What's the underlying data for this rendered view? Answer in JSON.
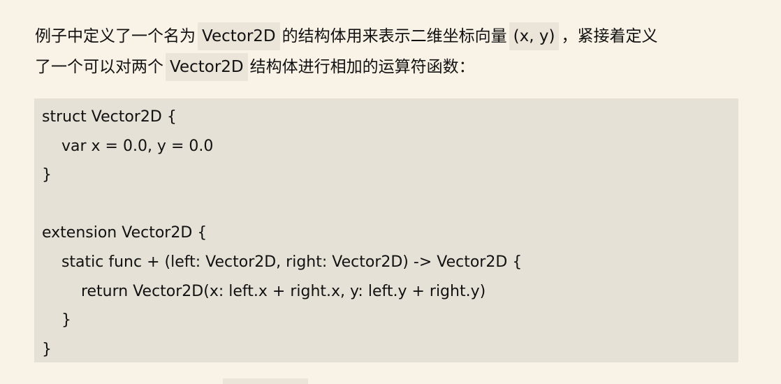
{
  "paragraph": {
    "line1": {
      "t1": "例子中定义了一个名为",
      "c1": "Vector2D",
      "t2": "的结构体用来表示二维坐标向量",
      "c2": "(x, y)",
      "t3": "，紧接着定义"
    },
    "line2": {
      "t1": "了一个可以对两个",
      "c1": "Vector2D",
      "t2": "结构体进行相加的运算符函数："
    }
  },
  "code_lines": [
    "struct Vector2D {",
    "    var x = 0.0, y = 0.0",
    "}",
    "",
    "extension Vector2D {",
    "    static func + (left: Vector2D, right: Vector2D) -> Vector2D {",
    "        return Vector2D(x: left.x + right.x, y: left.y + right.y)",
    "    }",
    "}"
  ]
}
